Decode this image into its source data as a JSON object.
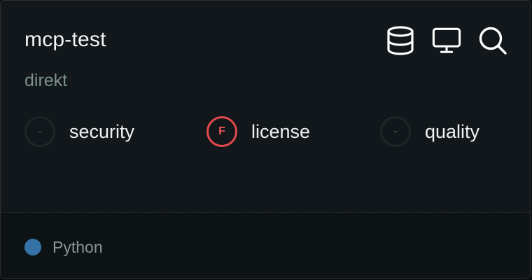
{
  "card": {
    "title": "mcp-test",
    "subtitle": "direkt",
    "header_icons": [
      "database-icon",
      "monitor-icon",
      "search-icon"
    ],
    "scores": [
      {
        "grade": "-",
        "label": "security",
        "status": "none"
      },
      {
        "grade": "F",
        "label": "license",
        "status": "fail"
      },
      {
        "grade": "-",
        "label": "quality",
        "status": "none"
      }
    ],
    "language": {
      "name": "Python",
      "color": "#3572a5"
    }
  },
  "colors": {
    "fail": "#e5484d",
    "subtitle": "#7b8f8d",
    "background": "#11171a"
  }
}
